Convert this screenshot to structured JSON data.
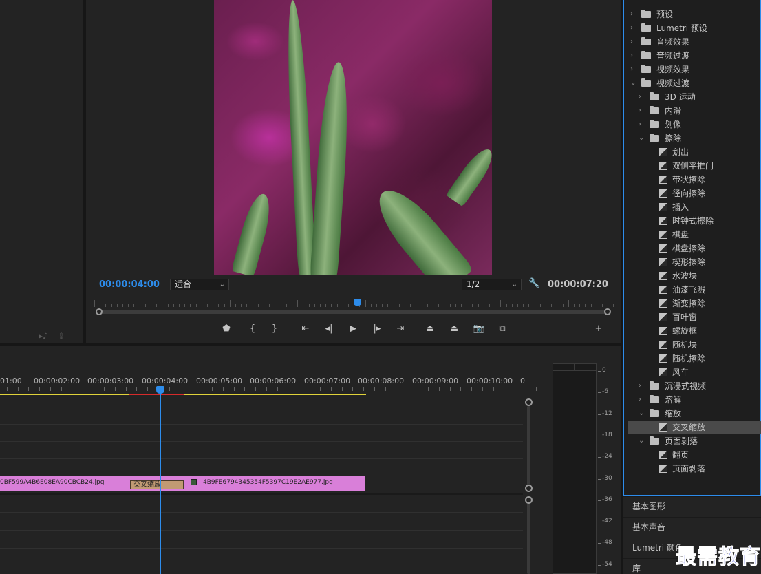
{
  "monitor": {
    "timecode_current": "00:00:04:00",
    "zoom": "适合",
    "resolution": "1/2",
    "timecode_duration": "00:00:07:20"
  },
  "transport_icons": [
    "marker-icon",
    "mark-in-icon",
    "mark-out-icon",
    "go-to-in-icon",
    "step-back-icon",
    "play-icon",
    "step-forward-icon",
    "go-to-out-icon",
    "lift-icon",
    "extract-icon",
    "export-frame-icon",
    "comparison-view-icon",
    "add-button-icon"
  ],
  "timeline": {
    "ruler_labels": [
      "01:00",
      "00:00:02:00",
      "00:00:03:00",
      "00:00:04:00",
      "00:00:05:00",
      "00:00:06:00",
      "00:00:07:00",
      "00:00:08:00",
      "00:00:09:00",
      "00:00:10:00",
      "0"
    ],
    "clip_a_name": "0BF599A4B6E08EA90CBCB24.jpg",
    "transition_name": "交叉缩放",
    "clip_b_name": "4B9FE6794345354F5397C19E2AE977.jpg"
  },
  "meter": {
    "db_labels": [
      "0",
      "-6",
      "-12",
      "-18",
      "-24",
      "-30",
      "-36",
      "-42",
      "-48",
      "-54"
    ]
  },
  "effects": {
    "items": [
      {
        "label": "预设",
        "level": 0,
        "type": "folder-special",
        "expanded": false
      },
      {
        "label": "Lumetri 预设",
        "level": 0,
        "type": "folder-special",
        "expanded": false
      },
      {
        "label": "音频效果",
        "level": 0,
        "type": "folder",
        "expanded": false
      },
      {
        "label": "音频过渡",
        "level": 0,
        "type": "folder",
        "expanded": false
      },
      {
        "label": "视频效果",
        "level": 0,
        "type": "folder",
        "expanded": false
      },
      {
        "label": "视频过渡",
        "level": 0,
        "type": "folder",
        "expanded": true
      },
      {
        "label": "3D 运动",
        "level": 1,
        "type": "folder",
        "expanded": false
      },
      {
        "label": "内滑",
        "level": 1,
        "type": "folder",
        "expanded": false
      },
      {
        "label": "划像",
        "level": 1,
        "type": "folder",
        "expanded": false
      },
      {
        "label": "擦除",
        "level": 1,
        "type": "folder",
        "expanded": true
      },
      {
        "label": "划出",
        "level": 2,
        "type": "effect"
      },
      {
        "label": "双侧平推门",
        "level": 2,
        "type": "effect"
      },
      {
        "label": "带状擦除",
        "level": 2,
        "type": "effect"
      },
      {
        "label": "径向擦除",
        "level": 2,
        "type": "effect"
      },
      {
        "label": "插入",
        "level": 2,
        "type": "effect"
      },
      {
        "label": "时钟式擦除",
        "level": 2,
        "type": "effect"
      },
      {
        "label": "棋盘",
        "level": 2,
        "type": "effect"
      },
      {
        "label": "棋盘擦除",
        "level": 2,
        "type": "effect"
      },
      {
        "label": "楔形擦除",
        "level": 2,
        "type": "effect"
      },
      {
        "label": "水波块",
        "level": 2,
        "type": "effect"
      },
      {
        "label": "油漆飞溅",
        "level": 2,
        "type": "effect"
      },
      {
        "label": "渐变擦除",
        "level": 2,
        "type": "effect"
      },
      {
        "label": "百叶窗",
        "level": 2,
        "type": "effect"
      },
      {
        "label": "螺旋框",
        "level": 2,
        "type": "effect"
      },
      {
        "label": "随机块",
        "level": 2,
        "type": "effect"
      },
      {
        "label": "随机擦除",
        "level": 2,
        "type": "effect"
      },
      {
        "label": "风车",
        "level": 2,
        "type": "effect"
      },
      {
        "label": "沉浸式视频",
        "level": 1,
        "type": "folder",
        "expanded": false
      },
      {
        "label": "溶解",
        "level": 1,
        "type": "folder",
        "expanded": false
      },
      {
        "label": "缩放",
        "level": 1,
        "type": "folder",
        "expanded": true
      },
      {
        "label": "交叉缩放",
        "level": 2,
        "type": "effect",
        "selected": true
      },
      {
        "label": "页面剥落",
        "level": 1,
        "type": "folder",
        "expanded": true
      },
      {
        "label": "翻页",
        "level": 2,
        "type": "effect"
      },
      {
        "label": "页面剥落",
        "level": 2,
        "type": "effect"
      }
    ]
  },
  "bottom_tabs": [
    "基本图形",
    "基本声音",
    "Lumetri 颜色",
    "库"
  ],
  "watermark": "最需教育",
  "colors": {
    "accent": "#2d8ceb",
    "clip": "#d97fd9",
    "transition": "#c19a73",
    "render_ok": "#e0d23a",
    "render_needed": "#d62b2b"
  }
}
